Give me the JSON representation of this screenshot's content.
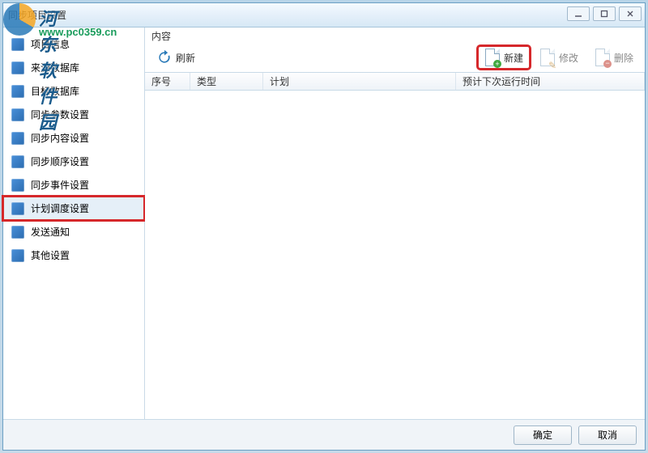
{
  "window": {
    "title": "同步项目设置"
  },
  "sidebar": {
    "items": [
      {
        "label": "项目信息",
        "selected": false
      },
      {
        "label": "来源数据库",
        "selected": false
      },
      {
        "label": "目标数据库",
        "selected": false
      },
      {
        "label": "同步参数设置",
        "selected": false
      },
      {
        "label": "同步内容设置",
        "selected": false
      },
      {
        "label": "同步顺序设置",
        "selected": false
      },
      {
        "label": "同步事件设置",
        "selected": false
      },
      {
        "label": "计划调度设置",
        "selected": true,
        "highlight": true
      },
      {
        "label": "发送通知",
        "selected": false
      },
      {
        "label": "其他设置",
        "selected": false
      }
    ]
  },
  "panel": {
    "header": "内容"
  },
  "toolbar": {
    "refresh_label": "刷新",
    "new_label": "新建",
    "edit_label": "修改",
    "delete_label": "删除"
  },
  "table": {
    "columns": {
      "seq": "序号",
      "type": "类型",
      "plan": "计划",
      "next_run": "预计下次运行时间"
    },
    "rows": []
  },
  "footer": {
    "ok_label": "确定",
    "cancel_label": "取消"
  },
  "watermark": {
    "name": "河东软件园",
    "url": "www.pc0359.cn"
  }
}
